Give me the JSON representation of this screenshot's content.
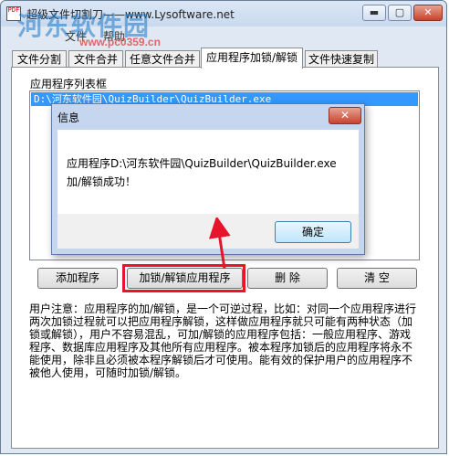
{
  "window": {
    "title": "超级文件切割刀——www.Lysoftware.net",
    "icon_glyph": "PDF",
    "minimize_glyph": "▬",
    "maximize_glyph": "▢",
    "close_glyph": "✕"
  },
  "menubar": {
    "items": [
      "文件",
      "帮助"
    ]
  },
  "watermark": {
    "text": "河东软件园",
    "url": "www.pc0359.cn"
  },
  "tabs": [
    {
      "label": "文件分割"
    },
    {
      "label": "文件合并"
    },
    {
      "label": "任意文件合并"
    },
    {
      "label": "应用程序加锁/解锁",
      "active": true
    },
    {
      "label": "文件快速复制"
    }
  ],
  "panel": {
    "list_label": "应用程序列表框",
    "list_items": [
      "D:\\河东软件园\\QuizBuilder\\QuizBuilder.exe"
    ],
    "buttons": {
      "add": "添加程序",
      "lock_unlock": "加锁/解锁应用程序",
      "delete": "删 除",
      "clear": "清 空"
    },
    "notice": "用户注意：应用程序的加/解锁，是一个可逆过程，比如：对同一个应用程序进行两次加锁过程就可以把应用程序解锁，这样做应用程序就只可能有两种状态（加锁或解锁），用户不容易混乱，可加/解锁的应用程序包括：一般应用程序、游戏程序、数据库应用程序及其他所有应用程序。被本程序加锁后的应用程序将永不能使用，除非且必须被本程序解锁后才可使用。能有效的保护用户的应用程序不被他人使用，可随时加锁/解锁。"
  },
  "dialog": {
    "title": "信息",
    "close_glyph": "✕",
    "message_line1": "应用程序D:\\河东软件园\\QuizBuilder\\QuizBuilder.exe",
    "message_line2": "加/解锁成功！",
    "ok_label": "确定"
  },
  "annotation": {
    "highlight_color": "#e8142b"
  }
}
